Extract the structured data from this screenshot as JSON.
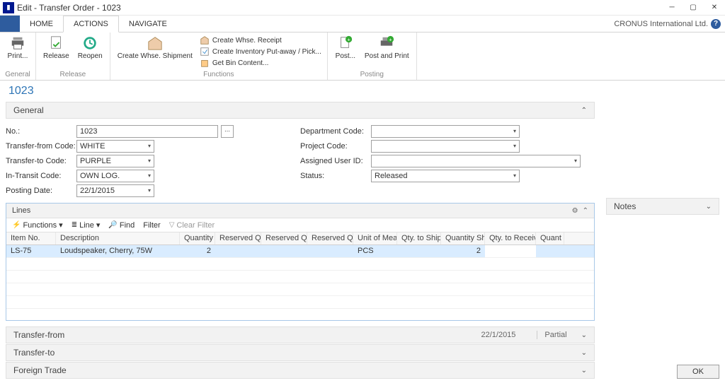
{
  "window": {
    "title": "Edit - Transfer Order - 1023",
    "company": "CRONUS International Ltd."
  },
  "menu": {
    "home": "HOME",
    "actions": "ACTIONS",
    "navigate": "NAVIGATE"
  },
  "ribbon": {
    "print": "Print...",
    "release": "Release",
    "reopen": "Reopen",
    "create_whse_shipment": "Create Whse. Shipment",
    "create_whse_receipt": "Create Whse. Receipt",
    "create_inv_putaway": "Create Inventory Put-away / Pick...",
    "get_bin_content": "Get Bin Content...",
    "post": "Post...",
    "post_and_print": "Post and Print",
    "g_general": "General",
    "g_release": "Release",
    "g_functions": "Functions",
    "g_posting": "Posting"
  },
  "page": {
    "title": "1023"
  },
  "fasttabs": {
    "general": "General",
    "notes": "Notes",
    "lines": "Lines",
    "transfer_from": "Transfer-from",
    "transfer_to": "Transfer-to",
    "foreign_trade": "Foreign Trade"
  },
  "fields": {
    "no_label": "No.:",
    "no_value": "1023",
    "transfer_from_label": "Transfer-from Code:",
    "transfer_from_value": "WHITE",
    "transfer_to_label": "Transfer-to Code:",
    "transfer_to_value": "PURPLE",
    "in_transit_label": "In-Transit Code:",
    "in_transit_value": "OWN LOG.",
    "posting_date_label": "Posting Date:",
    "posting_date_value": "22/1/2015",
    "department_label": "Department Code:",
    "department_value": "",
    "project_label": "Project Code:",
    "project_value": "",
    "assigned_user_label": "Assigned User ID:",
    "assigned_user_value": "",
    "status_label": "Status:",
    "status_value": "Released"
  },
  "lines_toolbar": {
    "functions": "Functions",
    "line": "Line",
    "find": "Find",
    "filter": "Filter",
    "clear_filter": "Clear Filter"
  },
  "grid": {
    "headers": {
      "item_no": "Item No.",
      "description": "Description",
      "quantity": "Quantity",
      "reserved_q1": "Reserved Qu...",
      "reserved_q2": "Reserved Qu...",
      "reserved_q3": "Reserved Qu...",
      "uom": "Unit of Mea...",
      "qty_to_ship": "Qty. to Ship",
      "qty_shi": "Quantity Shi...",
      "qty_to_receive": "Qty. to Receive",
      "quant": "Quant"
    },
    "rows": [
      {
        "item_no": "LS-75",
        "description": "Loudspeaker, Cherry, 75W",
        "quantity": "2",
        "reserved_q1": "",
        "reserved_q2": "",
        "reserved_q3": "",
        "uom": "PCS",
        "qty_to_ship": "",
        "qty_shi": "2",
        "qty_to_receive": "",
        "quant": ""
      }
    ]
  },
  "transfer_from_summary": {
    "date": "22/1/2015",
    "shipment": "Partial"
  },
  "footer": {
    "ok": "OK"
  }
}
